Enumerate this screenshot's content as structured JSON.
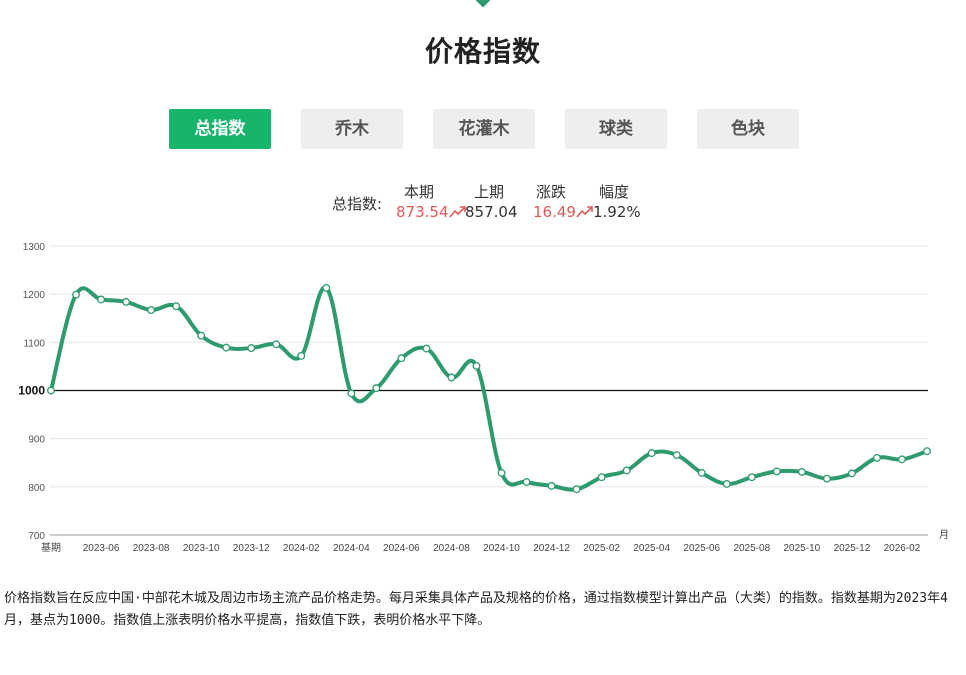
{
  "page": {
    "title": "价格指数"
  },
  "tabs": [
    {
      "label": "总指数",
      "active": true
    },
    {
      "label": "乔木",
      "active": false
    },
    {
      "label": "花灌木",
      "active": false
    },
    {
      "label": "球类",
      "active": false
    },
    {
      "label": "色块",
      "active": false
    }
  ],
  "summary": {
    "label": "总指数:",
    "current": {
      "header": "本期",
      "value": "873.54"
    },
    "previous": {
      "header": "上期",
      "value": "857.04"
    },
    "change": {
      "header": "涨跌",
      "value": "16.49"
    },
    "percent": {
      "header": "幅度",
      "value": "1.92%"
    },
    "up_color": "#e05a5a"
  },
  "chart_data": {
    "type": "line",
    "title": "",
    "xlabel": "月",
    "ylabel": "",
    "ylim": [
      700,
      1300
    ],
    "yticks": [
      700,
      800,
      900,
      1000,
      1100,
      1200,
      1300
    ],
    "baseline": 1000,
    "line_color": "#2e9b6e",
    "grid": true,
    "x_tick_labels": [
      "基期",
      "2023-06",
      "2023-08",
      "2023-10",
      "2023-12",
      "2024-02",
      "2024-04",
      "2024-06",
      "2024-08",
      "2024-10",
      "2024-12",
      "2025-02",
      "2025-04",
      "2025-06",
      "2025-08",
      "2025-10",
      "2025-12",
      "2026-02"
    ],
    "x": [
      "基期",
      "2023-05",
      "2023-06",
      "2023-07",
      "2023-08",
      "2023-09",
      "2023-10",
      "2023-11",
      "2023-12",
      "2024-01",
      "2024-02",
      "2024-03",
      "2024-04",
      "2024-05",
      "2024-06",
      "2024-07",
      "2024-08",
      "2024-09",
      "2024-10",
      "2024-11",
      "2024-12",
      "2025-01",
      "2025-02",
      "2025-03",
      "2025-04",
      "2025-05",
      "2025-06",
      "2025-07",
      "2025-08",
      "2025-09",
      "2025-10",
      "2025-11",
      "2025-12",
      "2026-01",
      "2026-02",
      "2026-03"
    ],
    "series": [
      {
        "name": "",
        "values": [
          1000,
          1199,
          1189,
          1184,
          1167,
          1175,
          1114,
          1089,
          1088,
          1096,
          1072,
          1213,
          994,
          1005,
          1067,
          1087,
          1027,
          1051,
          829,
          810,
          802,
          795,
          820,
          834,
          870,
          866,
          829,
          806,
          820,
          832,
          831,
          817,
          828,
          860,
          857,
          874
        ]
      }
    ]
  },
  "description": "价格指数旨在反应中国·中部花木城及周边市场主流产品价格走势。每月采集具体产品及规格的价格，通过指数模型计算出产品（大类）的指数。指数基期为2023年4月，基点为1000。指数值上涨表明价格水平提高，指数值下跌，表明价格水平下降。"
}
